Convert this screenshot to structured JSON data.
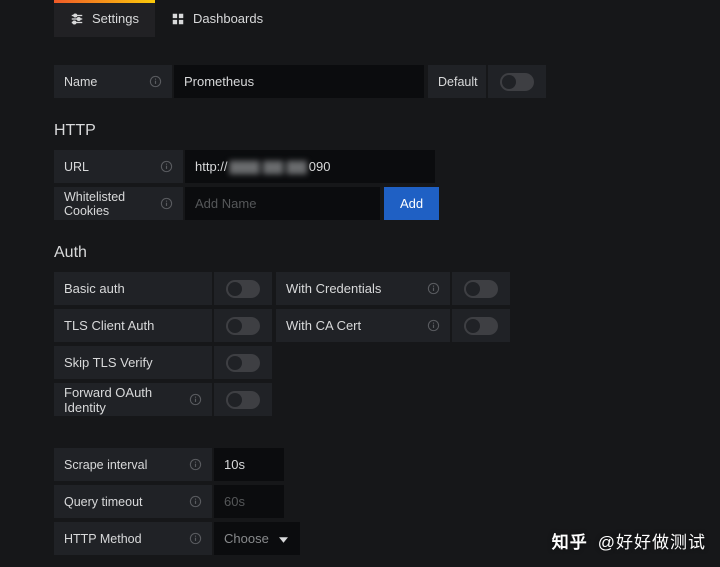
{
  "tabs": {
    "settings": "Settings",
    "dashboards": "Dashboards"
  },
  "name": {
    "label": "Name",
    "value": "Prometheus",
    "default_label": "Default",
    "default_on": false
  },
  "http": {
    "section": "HTTP",
    "url_label": "URL",
    "url_value_prefix": "http://",
    "url_value_redacted": "▇▇▇ ▇▇ ▇▇",
    "url_value_suffix": "090",
    "cookies_label": "Whitelisted Cookies",
    "cookies_placeholder": "Add Name",
    "add_button": "Add"
  },
  "auth": {
    "section": "Auth",
    "basic": "Basic auth",
    "with_credentials": "With Credentials",
    "tls_client": "TLS Client Auth",
    "with_ca": "With CA Cert",
    "skip_tls": "Skip TLS Verify",
    "forward_oauth": "Forward OAuth Identity"
  },
  "extra": {
    "scrape_label": "Scrape interval",
    "scrape_value": "10s",
    "query_label": "Query timeout",
    "query_placeholder": "60s",
    "method_label": "HTTP Method",
    "method_value": "Choose"
  },
  "watermark": {
    "brand": "知乎",
    "handle": "@好好做测试"
  }
}
